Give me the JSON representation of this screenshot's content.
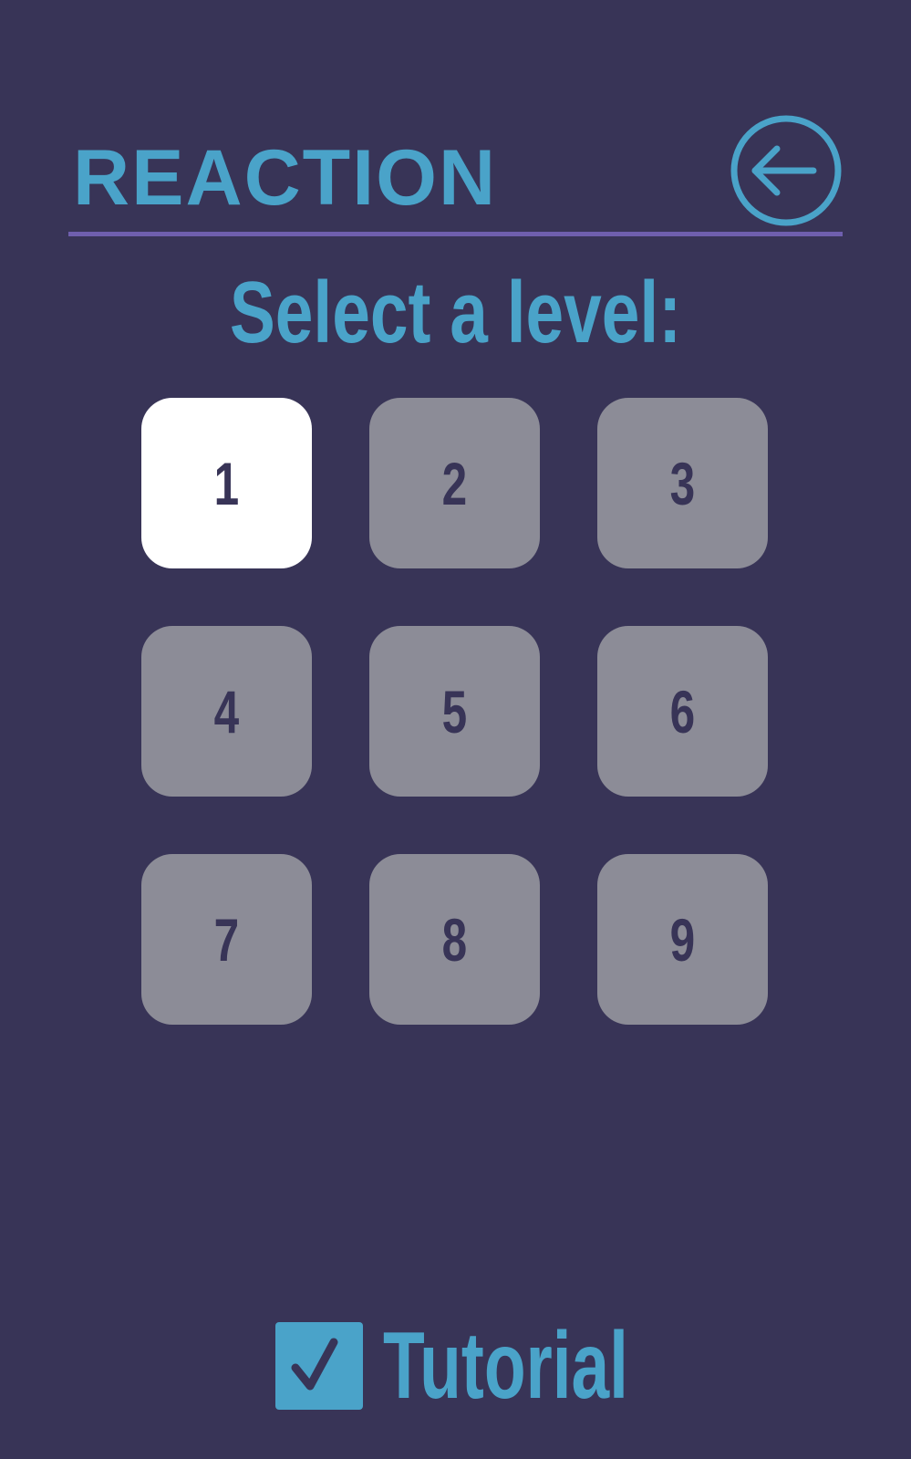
{
  "header": {
    "logo_text": "REACTION",
    "back_icon": "arrow-left-circle-icon"
  },
  "main": {
    "title": "Select a level:",
    "levels": [
      {
        "label": "1",
        "selected": true
      },
      {
        "label": "2",
        "selected": false
      },
      {
        "label": "3",
        "selected": false
      },
      {
        "label": "4",
        "selected": false
      },
      {
        "label": "5",
        "selected": false
      },
      {
        "label": "6",
        "selected": false
      },
      {
        "label": "7",
        "selected": false
      },
      {
        "label": "8",
        "selected": false
      },
      {
        "label": "9",
        "selected": false
      }
    ]
  },
  "footer": {
    "tutorial_label": "Tutorial",
    "tutorial_checked": true,
    "check_icon": "checkmark-icon"
  },
  "colors": {
    "background": "#383457",
    "accent": "#4aa3c9",
    "divider": "#6f5fae",
    "tile_default": "#8c8c97",
    "tile_selected": "#ffffff",
    "tile_text": "#383457"
  }
}
